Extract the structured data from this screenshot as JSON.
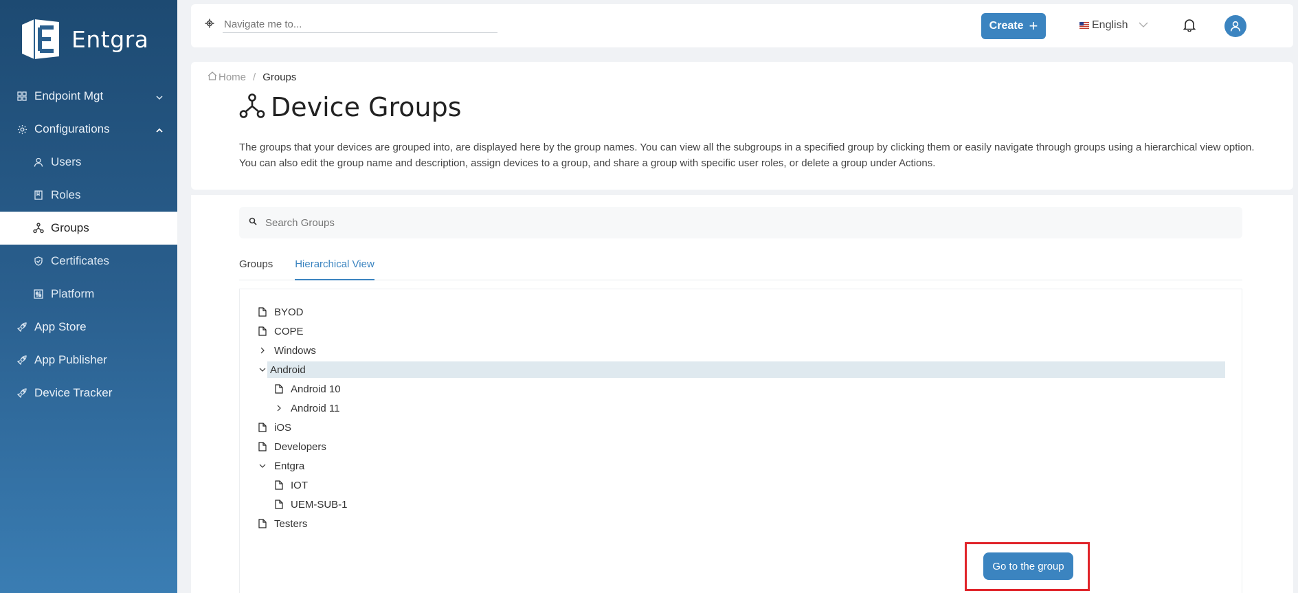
{
  "app": {
    "brand": "Entgra"
  },
  "sidebar": {
    "items": [
      {
        "label": "Endpoint Mgt",
        "icon": "grid-icon",
        "caret": "down"
      },
      {
        "label": "Configurations",
        "icon": "gear-icon",
        "caret": "up"
      },
      {
        "label": "Users",
        "icon": "user-icon"
      },
      {
        "label": "Roles",
        "icon": "book-icon"
      },
      {
        "label": "Groups",
        "icon": "groups-icon"
      },
      {
        "label": "Certificates",
        "icon": "shield-check-icon"
      },
      {
        "label": "Platform",
        "icon": "sliders-icon"
      },
      {
        "label": "App Store",
        "icon": "rocket-icon"
      },
      {
        "label": "App Publisher",
        "icon": "rocket-icon"
      },
      {
        "label": "Device Tracker",
        "icon": "rocket-icon"
      }
    ]
  },
  "topbar": {
    "search_placeholder": "Navigate me to...",
    "create_label": "Create",
    "language": "English"
  },
  "breadcrumb": {
    "home": "Home",
    "current": "Groups"
  },
  "page": {
    "title": "Device Groups",
    "description": "The groups that your devices are grouped into, are displayed here by the group names. You can view all the subgroups in a specified group by clicking them or easily navigate through groups using a hierarchical view option. You can also edit the group name and description, assign devices to a group, and share a group with specific user roles, or delete a group under Actions."
  },
  "search": {
    "placeholder": "Search Groups"
  },
  "tabs": [
    {
      "label": "Groups",
      "active": false
    },
    {
      "label": "Hierarchical View",
      "active": true
    }
  ],
  "tree": [
    {
      "label": "BYOD",
      "type": "leaf",
      "depth": 0
    },
    {
      "label": "COPE",
      "type": "leaf",
      "depth": 0
    },
    {
      "label": "Windows",
      "type": "collapsed",
      "depth": 0
    },
    {
      "label": "Android",
      "type": "expanded",
      "depth": 0,
      "selected": true
    },
    {
      "label": "Android 10",
      "type": "leaf",
      "depth": 1
    },
    {
      "label": "Android 11",
      "type": "collapsed",
      "depth": 1
    },
    {
      "label": "iOS",
      "type": "leaf",
      "depth": 0
    },
    {
      "label": "Developers",
      "type": "leaf",
      "depth": 0
    },
    {
      "label": "Entgra",
      "type": "expanded",
      "depth": 0
    },
    {
      "label": "IOT",
      "type": "leaf",
      "depth": 1
    },
    {
      "label": "UEM-SUB-1",
      "type": "leaf",
      "depth": 1
    },
    {
      "label": "Testers",
      "type": "leaf",
      "depth": 0
    }
  ],
  "actions": {
    "go_to_group": "Go to the group"
  },
  "colors": {
    "primary": "#3b84c0",
    "highlight": "#e0242a",
    "selected_row": "#dfe9ef"
  }
}
